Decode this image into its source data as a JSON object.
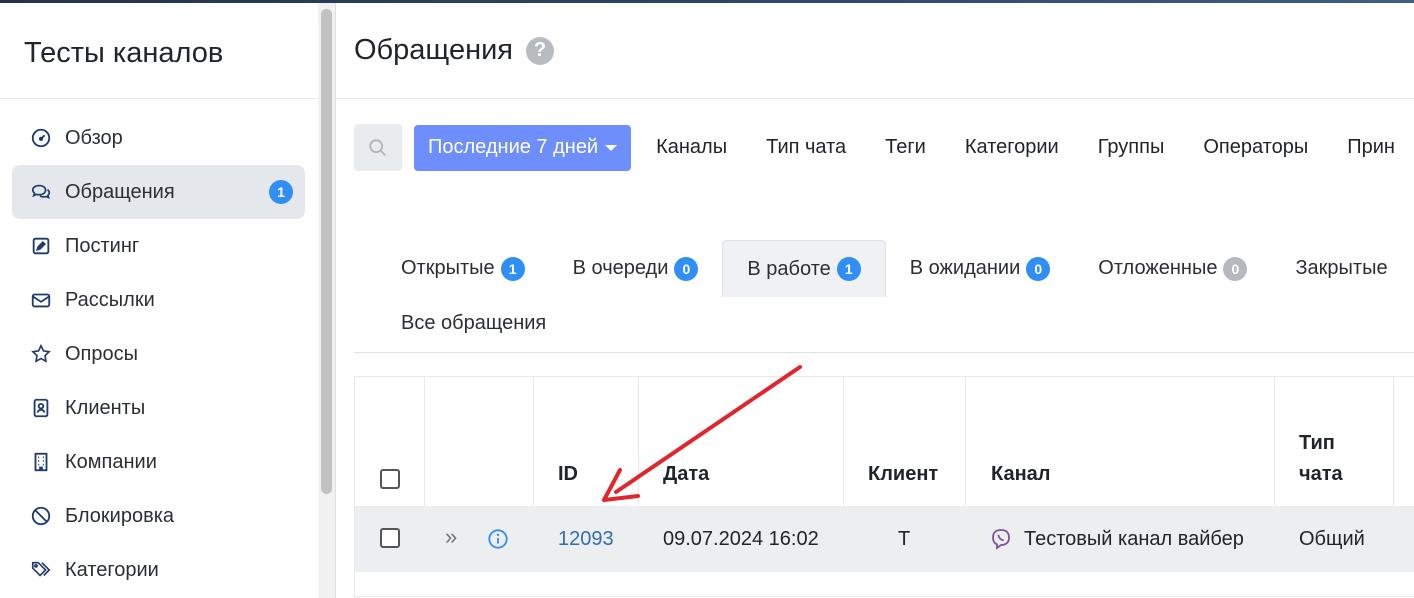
{
  "sidebar": {
    "title": "Тесты каналов",
    "items": [
      {
        "label": "Обзор",
        "icon": "gauge-icon"
      },
      {
        "label": "Обращения",
        "icon": "chat-bubbles-icon",
        "badge": "1",
        "active": true
      },
      {
        "label": "Постинг",
        "icon": "edit-square-icon"
      },
      {
        "label": "Рассылки",
        "icon": "envelope-icon"
      },
      {
        "label": "Опросы",
        "icon": "star-icon"
      },
      {
        "label": "Клиенты",
        "icon": "contact-card-icon"
      },
      {
        "label": "Компании",
        "icon": "building-icon"
      },
      {
        "label": "Блокировка",
        "icon": "ban-icon"
      },
      {
        "label": "Категории",
        "icon": "tags-icon"
      }
    ]
  },
  "main": {
    "title": "Обращения",
    "help": "?",
    "filters": {
      "period": "Последние 7 дней",
      "links": [
        "Каналы",
        "Тип чата",
        "Теги",
        "Категории",
        "Группы",
        "Операторы",
        "Прин"
      ]
    },
    "tabs": [
      {
        "label": "Открытые",
        "count": "1"
      },
      {
        "label": "В очереди",
        "count": "0"
      },
      {
        "label": "В работе",
        "count": "1",
        "active": true
      },
      {
        "label": "В ожидании",
        "count": "0"
      },
      {
        "label": "Отложенные",
        "count": "0",
        "muted": true
      },
      {
        "label": "Закрытые",
        "count": ""
      }
    ],
    "all_tab": "Все обращения",
    "table": {
      "headers": {
        "id": "ID",
        "date": "Дата",
        "client": "Клиент",
        "channel": "Канал",
        "chat_type_1": "Тип",
        "chat_type_2": "чата"
      },
      "rows": [
        {
          "id": "12093",
          "date": "09.07.2024 16:02",
          "client": "Т",
          "channel": "Тестовый канал вайбер",
          "chat_type": "Общий"
        }
      ]
    }
  },
  "colors": {
    "accent": "#6d8efb",
    "badge": "#2f8ff5",
    "annotation_arrow": "#e0262b"
  }
}
